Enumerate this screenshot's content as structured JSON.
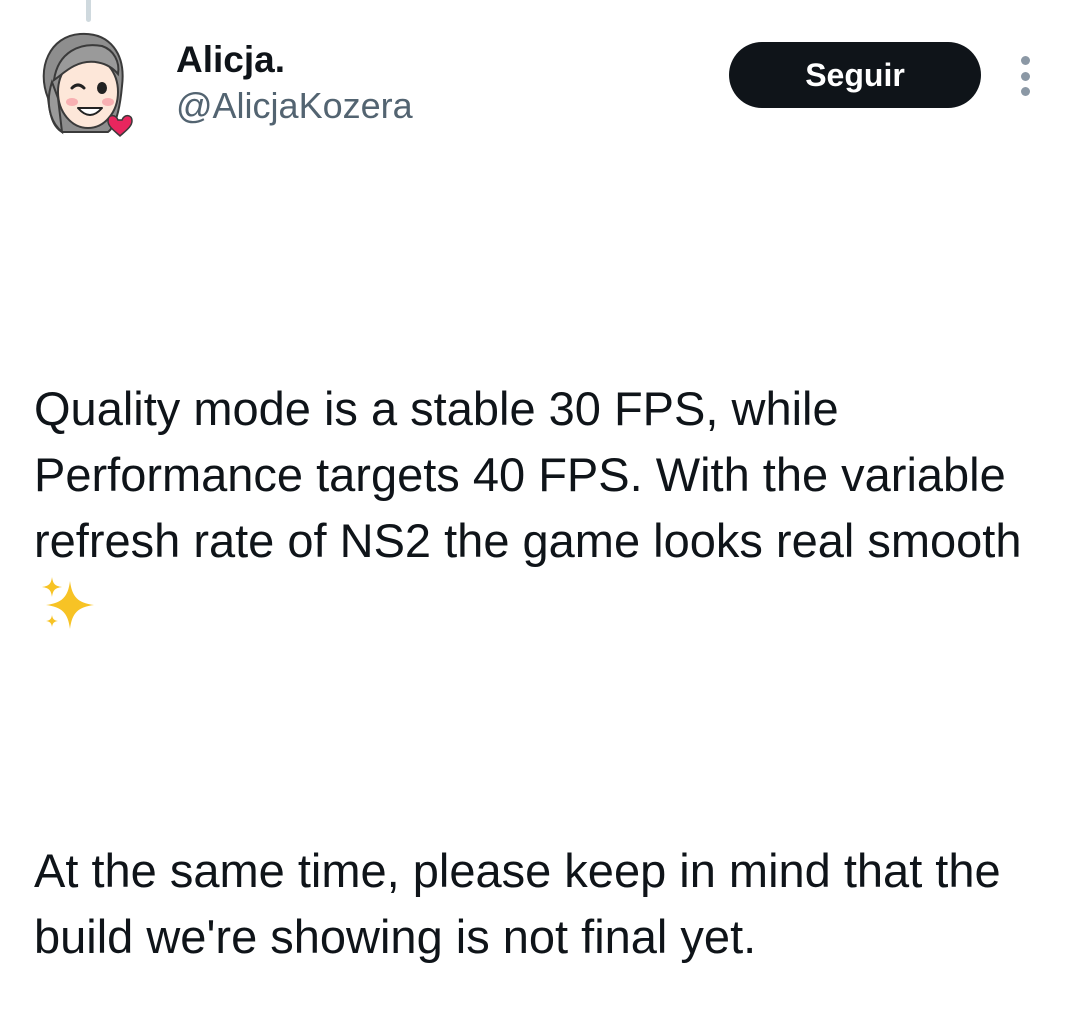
{
  "post": {
    "author": {
      "display_name": "Alicja.",
      "handle": "@AlicjaKozera",
      "avatar_icon": "cartoon-avatar-icon"
    },
    "follow_label": "Seguir",
    "more_icon": "more-vertical-icon",
    "text_paragraph_1": "Quality mode is a stable 30 FPS, while Performance targets 40 FPS. With the variable refresh rate of NS2 the game looks real smooth",
    "text_emoji_icon": "sparkles-icon",
    "text_paragraph_2": "At the same time, please keep in mind that the build we're showing is not final yet."
  },
  "colors": {
    "follow_button_bg": "#0f1419",
    "text_primary": "#0f1419",
    "text_secondary": "#536471",
    "sparkle_yellow": "#f7c325",
    "heart_pink": "#e8265e"
  }
}
